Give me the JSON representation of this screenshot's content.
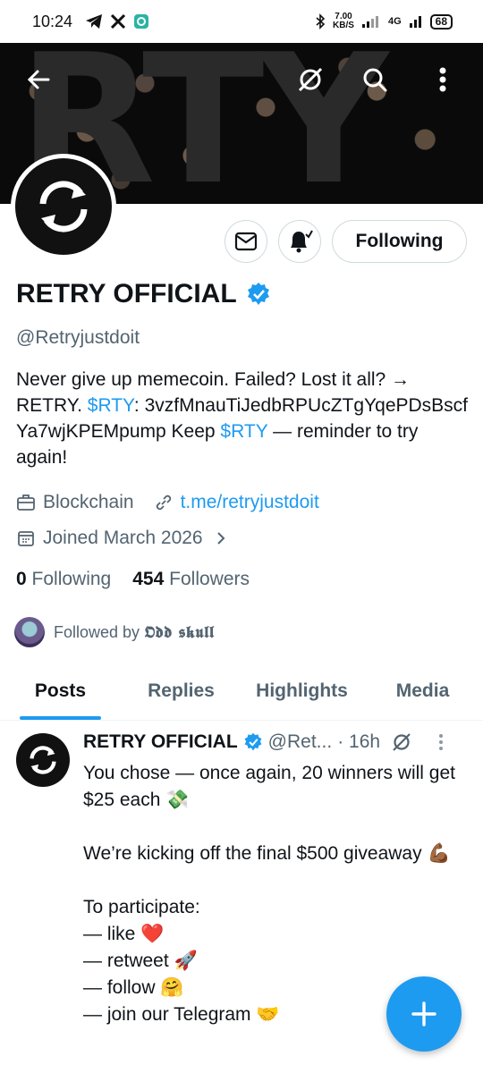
{
  "status_bar": {
    "time": "10:24",
    "speed_value": "7.00",
    "speed_unit": "KB/S",
    "network": "4G",
    "battery": "68"
  },
  "banner": {
    "text": "RTY"
  },
  "profile": {
    "name": "RETRY OFFICIAL",
    "handle": "@Retryjustdoit",
    "following_button": "Following",
    "bio": {
      "part1": "Never give up memecoin.  Failed? Lost it all? → RETRY. ",
      "cashtag1": "$RTY",
      "part2": ": 3vzfMnauTiJedbRPUcZTgYqePDsBscfYa7wjKPEMpump  Keep ",
      "cashtag2": "$RTY",
      "part3": " — reminder to try again!"
    },
    "category": "Blockchain",
    "website": "t.me/retryjustdoit",
    "joined": "Joined March 2026",
    "following_count": "0",
    "following_label": "Following",
    "followers_count": "454",
    "followers_label": "Followers",
    "followed_by_prefix": "Followed by ",
    "followed_by_name": "𝕺𝖉𝖉 𝖘𝖐𝖚𝖑𝖑"
  },
  "tabs": [
    {
      "label": "Posts",
      "active": true
    },
    {
      "label": "Replies",
      "active": false
    },
    {
      "label": "Highlights",
      "active": false
    },
    {
      "label": "Media",
      "active": false
    }
  ],
  "tweet": {
    "name": "RETRY OFFICIAL",
    "handle": "@Ret...",
    "time": "· 16h",
    "body": "You chose — once again, 20 winners will get $25 each 💸\n\nWe’re kicking off the final $500 giveaway 💪🏾\n\nTo participate:\n— like ❤️\n— retweet 🚀\n— follow 🤗\n— join our Telegram 🤝"
  },
  "colors": {
    "accent": "#1d9bf0",
    "secondary_text": "#536471",
    "border": "#cfd9de"
  }
}
